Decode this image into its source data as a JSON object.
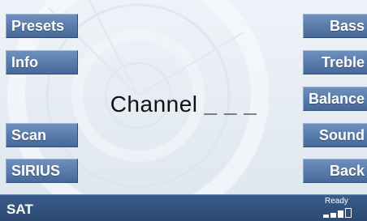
{
  "left_buttons": [
    {
      "label": "Presets"
    },
    {
      "label": "Info"
    },
    {
      "label": "Scan"
    },
    {
      "label": "SIRIUS"
    }
  ],
  "right_buttons": [
    {
      "label": "Bass"
    },
    {
      "label": "Treble"
    },
    {
      "label": "Balance"
    },
    {
      "label": "Sound"
    },
    {
      "label": "Back"
    }
  ],
  "channel": {
    "label": "Channel",
    "value": "_ _ _"
  },
  "status_bar": {
    "source": "SAT",
    "ready_text": "Ready",
    "signal_icon": "signal-strength-icon",
    "signal_level": 0.6
  },
  "colors": {
    "button_fill": "#5a7dad",
    "status_bar": "#34557f",
    "screen_bg": "#e6ecf3"
  }
}
